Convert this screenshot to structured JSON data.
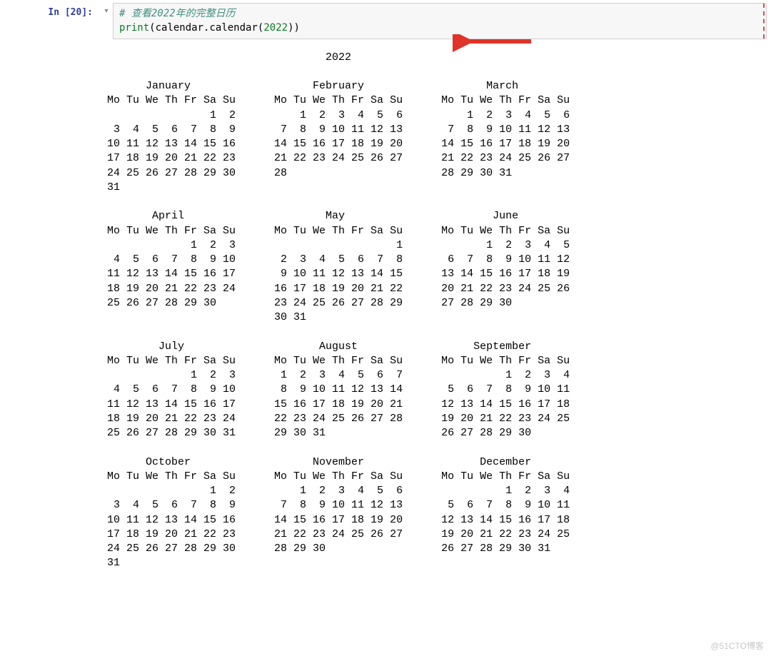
{
  "prompt": "In [20]:",
  "run_marker": "▾",
  "code": {
    "comment": "# 查看2022年的完整日历",
    "line2_print": "print",
    "line2_open": "(",
    "line2_mod": "calendar",
    "line2_dot": ".",
    "line2_func": "calendar",
    "line2_open2": "(",
    "line2_num": "2022",
    "line2_close2": ")",
    "line2_close": ")"
  },
  "calendar": {
    "year": "2022",
    "dow": "Mo Tu We Th Fr Sa Su",
    "months": [
      {
        "name": "January",
        "rows": [
          "                1  2",
          " 3  4  5  6  7  8  9",
          "10 11 12 13 14 15 16",
          "17 18 19 20 21 22 23",
          "24 25 26 27 28 29 30",
          "31"
        ]
      },
      {
        "name": "February",
        "rows": [
          "    1  2  3  4  5  6",
          " 7  8  9 10 11 12 13",
          "14 15 16 17 18 19 20",
          "21 22 23 24 25 26 27",
          "28"
        ]
      },
      {
        "name": "March",
        "rows": [
          "    1  2  3  4  5  6",
          " 7  8  9 10 11 12 13",
          "14 15 16 17 18 19 20",
          "21 22 23 24 25 26 27",
          "28 29 30 31"
        ]
      },
      {
        "name": "April",
        "rows": [
          "             1  2  3",
          " 4  5  6  7  8  9 10",
          "11 12 13 14 15 16 17",
          "18 19 20 21 22 23 24",
          "25 26 27 28 29 30"
        ]
      },
      {
        "name": "May",
        "rows": [
          "                   1",
          " 2  3  4  5  6  7  8",
          " 9 10 11 12 13 14 15",
          "16 17 18 19 20 21 22",
          "23 24 25 26 27 28 29",
          "30 31"
        ]
      },
      {
        "name": "June",
        "rows": [
          "       1  2  3  4  5",
          " 6  7  8  9 10 11 12",
          "13 14 15 16 17 18 19",
          "20 21 22 23 24 25 26",
          "27 28 29 30"
        ]
      },
      {
        "name": "July",
        "rows": [
          "             1  2  3",
          " 4  5  6  7  8  9 10",
          "11 12 13 14 15 16 17",
          "18 19 20 21 22 23 24",
          "25 26 27 28 29 30 31"
        ]
      },
      {
        "name": "August",
        "rows": [
          " 1  2  3  4  5  6  7",
          " 8  9 10 11 12 13 14",
          "15 16 17 18 19 20 21",
          "22 23 24 25 26 27 28",
          "29 30 31"
        ]
      },
      {
        "name": "September",
        "rows": [
          "          1  2  3  4",
          " 5  6  7  8  9 10 11",
          "12 13 14 15 16 17 18",
          "19 20 21 22 23 24 25",
          "26 27 28 29 30"
        ]
      },
      {
        "name": "October",
        "rows": [
          "                1  2",
          " 3  4  5  6  7  8  9",
          "10 11 12 13 14 15 16",
          "17 18 19 20 21 22 23",
          "24 25 26 27 28 29 30",
          "31"
        ]
      },
      {
        "name": "November",
        "rows": [
          "    1  2  3  4  5  6",
          " 7  8  9 10 11 12 13",
          "14 15 16 17 18 19 20",
          "21 22 23 24 25 26 27",
          "28 29 30"
        ]
      },
      {
        "name": "December",
        "rows": [
          "          1  2  3  4",
          " 5  6  7  8  9 10 11",
          "12 13 14 15 16 17 18",
          "19 20 21 22 23 24 25",
          "26 27 28 29 30 31"
        ]
      }
    ]
  },
  "watermark": "@51CTO博客"
}
